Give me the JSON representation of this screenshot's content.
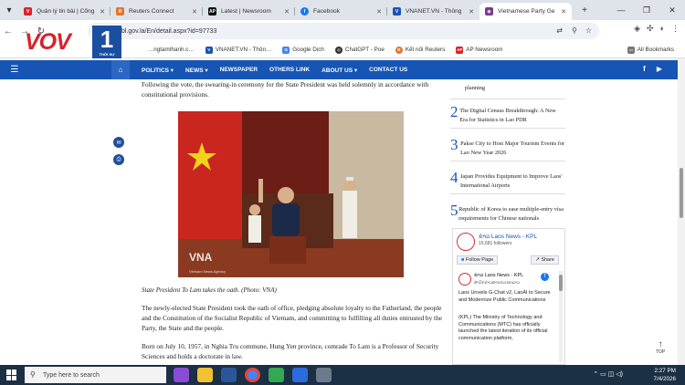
{
  "tabs": [
    {
      "title": "Quản lý tin bài | Cổng",
      "color": "#d8222a",
      "active": false
    },
    {
      "title": "Reuters Connect",
      "color": "#e2762b",
      "active": false
    },
    {
      "title": "Latest | Newsroom",
      "color": "#111111",
      "active": false
    },
    {
      "title": "Facebook",
      "color": "#1877f2",
      "active": false
    },
    {
      "title": "VNANET.VN - Thông",
      "color": "#1655b4",
      "active": false
    },
    {
      "title": "Vietnamese Party Ge",
      "color": "#7a3a8a",
      "active": true
    }
  ],
  "new_tab": "+",
  "address": {
    "url": "…bl.gov.la/En/detail.aspx?id=97733"
  },
  "bookmarks": [
    {
      "label": "…ngtamthanh.c…",
      "color": "#c33"
    },
    {
      "label": "VNANET.VN - Thôn…",
      "color": "#1655b4"
    },
    {
      "label": "Google Dịch",
      "color": "#4285f4"
    },
    {
      "label": "ChatGPT - Poe",
      "color": "#333333"
    },
    {
      "label": "Kết nối Reuters",
      "color": "#e2762b"
    },
    {
      "label": "AP Newsroom",
      "color": "#d8222a"
    }
  ],
  "all_bookmarks": "All Bookmarks",
  "logo": {
    "text": "VOV",
    "num": "1",
    "sub": "THỜI SỰ"
  },
  "sitenav": [
    "POLITICS ▾",
    "NEWS ▾",
    "NEWSPAPER",
    "OTHERS LINK",
    "ABOUT US ▾",
    "CONTACT US"
  ],
  "social": {
    "fb": "f",
    "yt": "▶"
  },
  "article": {
    "p1": "Following the vote, the swearing-in ceremony for the State President was held solemnly in accordance with constitutional provisions.",
    "photo_credit": "VNA",
    "photo_credit_sub": "Vietnam News Agency",
    "caption": "State President To Lam takes the oath. (Photo: VNA)",
    "p2": "The newly-elected State President took the oath of office, pledging absolute loyalty to the Fatherland, the people and the Constitution of the Socialist Republic of Vietnam, and committing to fulfilling all duties entrusted by the Party, the State and the people.",
    "p3": "Born on July 10, 1957, in Nghia Tru commune, Hung Yen province, comrade To Lam is a Professor of Security Sciences and holds a doctorate in law."
  },
  "rail": [
    {
      "n": "",
      "t": "planning"
    },
    {
      "n": "2",
      "t": "The Digital Census Breakthrough: A New Era for Statistics in Lao PDR"
    },
    {
      "n": "3",
      "t": "Pakse City to Host Major Tourism Events for Lao New Year 2026"
    },
    {
      "n": "4",
      "t": "Japan Provides Equipment to Improve Laos' International Airports"
    },
    {
      "n": "5",
      "t": "Republic of Korea to ease multiple-entry visa requirements for Chinese nationals"
    }
  ],
  "fb_widget": {
    "page": "ຂ່າວ Laos News - KPL",
    "followers": "15,681 followers",
    "follow": "Follow Page",
    "share": "Share",
    "post_page": "ຂ່າວ Laos News - KPL",
    "post_sub": "ສຳນັກຂ່າວສານປະເທດລາວ",
    "post_title": "Laos Unveils G-Chat v2, LaoAI to Secure and Modernize Public Communications",
    "post_body": "(KPL) The Ministry of Technology and Communications (MTC) has officially launched the latest iteration of its official communication platform,"
  },
  "to_top": "TOP",
  "taskbar": {
    "search": "Type here to search",
    "time": "2:27 PM",
    "date": "7/4/2026"
  }
}
